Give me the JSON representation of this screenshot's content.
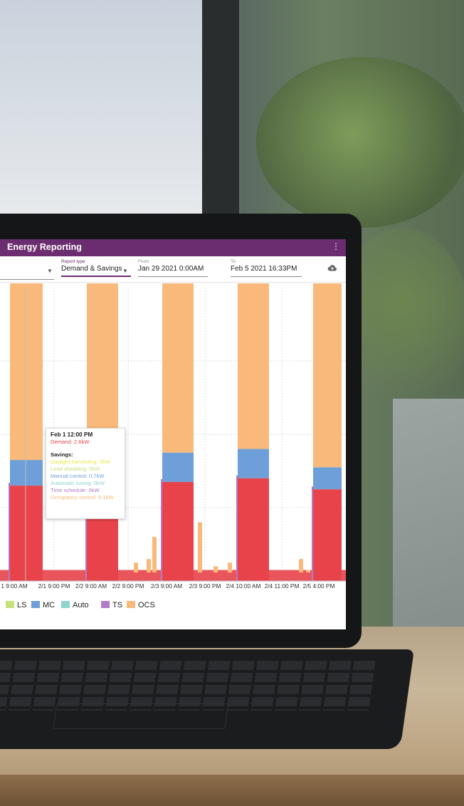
{
  "app": {
    "title": "Energy Reporting",
    "menu_icon": "more-vert-icon"
  },
  "filters": {
    "report_type": {
      "label": "Report type",
      "value": "Demand & Savings"
    },
    "from": {
      "label": "From",
      "value": "Jan 29 2021 0:00AM"
    },
    "to": {
      "label": "To",
      "value": "Feb 5 2021 16:33PM"
    },
    "download_icon": "cloud-download-icon"
  },
  "tooltip": {
    "time": "Feb 1 12:00 PM",
    "demand": "Demand: 2.6kW",
    "savings_title": "Savings:",
    "lines": [
      {
        "text": "Daylight harvesting: 0kW",
        "color": "#e8e84a"
      },
      {
        "text": "Load shedding: 0kW",
        "color": "#c6e07a"
      },
      {
        "text": "Manual control: 0.7kW",
        "color": "#6f9fd8"
      },
      {
        "text": "Automatic tuning: 0kW",
        "color": "#8fd3cf"
      },
      {
        "text": "Time schedule: 0kW",
        "color": "#b07cc6"
      },
      {
        "text": "Occupancy control: 5.1kW",
        "color": "#f9b97a"
      }
    ]
  },
  "legend": [
    {
      "label": "LS",
      "color": "#c6e07a"
    },
    {
      "label": "MC",
      "color": "#6f9fd8"
    },
    {
      "label": "Auto",
      "color": "#8fd3cf"
    },
    {
      "label": "TS",
      "color": "#b07cc6"
    },
    {
      "label": "OCS",
      "color": "#f9b97a"
    }
  ],
  "colors": {
    "demand": "#e8434a",
    "accent": "#6b2d6f"
  },
  "chart_data": {
    "type": "area",
    "stacked": true,
    "x_tick_labels": [
      "1 9:00 AM",
      "2/1 9:00 PM",
      "2/2 9:00 AM",
      "2/2 9:00 PM",
      "2/3 9:00 AM",
      "2/3 9:00 PM",
      "2/4 10:00 AM",
      "2/4 11:00 PM",
      "2/5 4:00 PM"
    ],
    "ylim": [
      0,
      8
    ],
    "grid": true,
    "legend_position": "bottom-left",
    "blocks": [
      {
        "period": "Feb 1 day",
        "demand": 2.6,
        "mc": 0.7,
        "ocs": 5.1
      },
      {
        "period": "Feb 2 day",
        "demand": 2.5,
        "mc": 0.6,
        "ocs": 5.4
      },
      {
        "period": "Feb 3 day",
        "demand": 2.7,
        "mc": 0.8,
        "ocs": 5.0
      },
      {
        "period": "Feb 4 day",
        "demand": 2.8,
        "mc": 0.8,
        "ocs": 4.9
      },
      {
        "period": "Feb 5 day",
        "demand": 2.5,
        "mc": 0.6,
        "ocs": 5.3
      }
    ],
    "night_demand": 0.3
  }
}
